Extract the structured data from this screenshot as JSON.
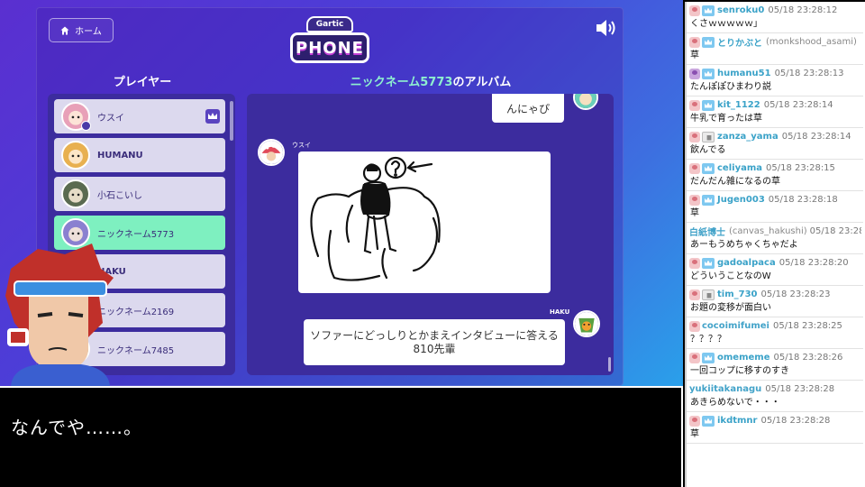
{
  "game": {
    "home_label": "ホーム",
    "logo_top": "Gartic",
    "logo_main": "PHONE",
    "players_title": "プレイヤー",
    "album_title_nick": "ニックネーム5773",
    "album_title_suffix": "のアルバム",
    "players": [
      {
        "name": "ウスイ",
        "bold": false,
        "active": false,
        "host": true,
        "color": "#e8a0b8"
      },
      {
        "name": "HUMANU",
        "bold": true,
        "active": false,
        "host": false,
        "color": "#e8b050"
      },
      {
        "name": "小石こいし",
        "bold": false,
        "active": false,
        "host": false,
        "color": "#5a6a50"
      },
      {
        "name": "ニックネーム5773",
        "bold": false,
        "active": true,
        "host": false,
        "color": "#8a80d0"
      },
      {
        "name": "HAKU",
        "bold": true,
        "active": false,
        "host": false,
        "color": "#f06a3a"
      },
      {
        "name": "ニックネーム2169",
        "bold": false,
        "active": false,
        "host": false,
        "color": "#a0b0d0"
      },
      {
        "name": "ニックネーム7485",
        "bold": false,
        "active": false,
        "host": false,
        "color": "#c0a070"
      }
    ],
    "album": {
      "top_bubble": "んにゃぴ",
      "drawing_author": "ウスイ",
      "caption_author": "HAKU",
      "caption": "ソファーにどっしりとかまえインタビューに答える810先輩"
    }
  },
  "subtitle": "なんでや……。",
  "chat": [
    {
      "user": "senroku0",
      "handle": "",
      "time": "05/18 23:28:12",
      "text": "くさｗｗｗｗｗ」",
      "badge": "premium",
      "avatar": "pink"
    },
    {
      "user": "とりかぶと",
      "handle": "(monkshood_asami)",
      "time": "",
      "text": "草",
      "badge": "premium",
      "avatar": "pink"
    },
    {
      "user": "humanu51",
      "handle": "",
      "time": "05/18 23:28:13",
      "text": "たんぽぽひまわり説",
      "badge": "premium",
      "avatar": "purple"
    },
    {
      "user": "kit_1122",
      "handle": "",
      "time": "05/18 23:28:14",
      "text": "牛乳で育ったは草",
      "badge": "premium",
      "avatar": "pink"
    },
    {
      "user": "zanza_yama",
      "handle": "",
      "time": "05/18 23:28:14",
      "text": "飲んでる",
      "badge": "mod",
      "avatar": "pink"
    },
    {
      "user": "celiyama",
      "handle": "",
      "time": "05/18 23:28:15",
      "text": "だんだん雑になるの草",
      "badge": "premium",
      "avatar": "pink"
    },
    {
      "user": "Jugen003",
      "handle": "",
      "time": "05/18 23:28:18",
      "text": "草",
      "badge": "premium",
      "avatar": "pink"
    },
    {
      "user": "白紙博士",
      "handle": "(canvas_hakushi)",
      "time": "05/18 23:28:",
      "text": "あーもうめちゃくちゃだよ",
      "badge": "",
      "avatar": ""
    },
    {
      "user": "gadoalpaca",
      "handle": "",
      "time": "05/18 23:28:20",
      "text": "どういうことなのW",
      "badge": "premium",
      "avatar": "pink"
    },
    {
      "user": "tim_730",
      "handle": "",
      "time": "05/18 23:28:23",
      "text": "お題の変移が面白い",
      "badge": "mod",
      "avatar": "pink"
    },
    {
      "user": "cocoimifumei",
      "handle": "",
      "time": "05/18 23:28:25",
      "text": "？？？？",
      "badge": "",
      "avatar": "pink"
    },
    {
      "user": "omememe",
      "handle": "",
      "time": "05/18 23:28:26",
      "text": "一回コップに移すのすき",
      "badge": "premium",
      "avatar": "pink"
    },
    {
      "user": "yukiitakanagu",
      "handle": "",
      "time": "05/18 23:28:28",
      "text": "あきらめないで・・・",
      "badge": "",
      "avatar": ""
    },
    {
      "user": "ikdtmnr",
      "handle": "",
      "time": "05/18 23:28:28",
      "text": "草",
      "badge": "premium",
      "avatar": "pink"
    }
  ]
}
